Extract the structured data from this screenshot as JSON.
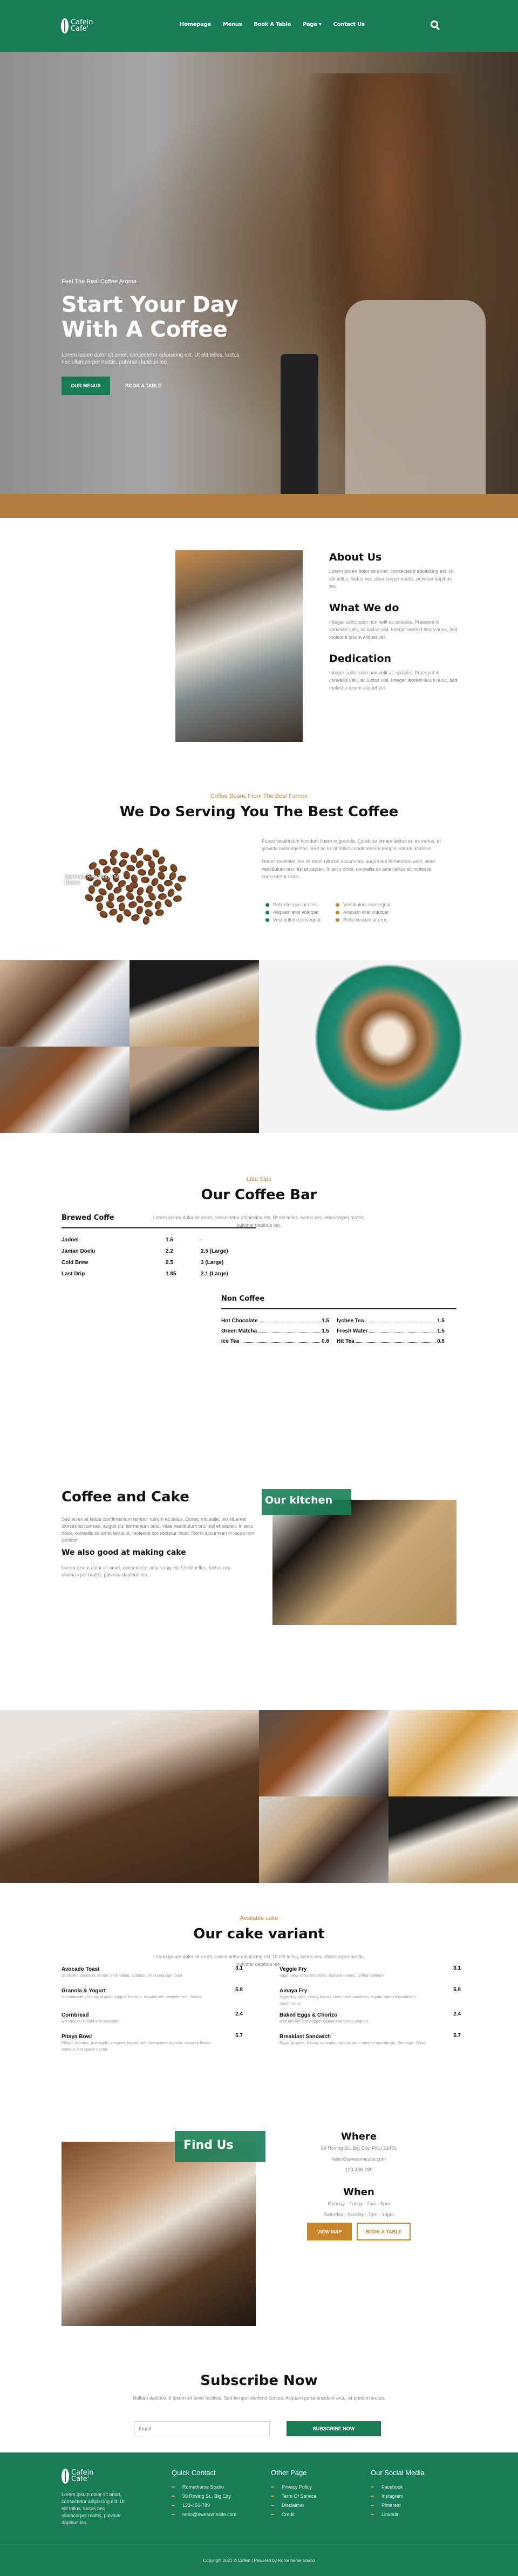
{
  "header": {
    "logo_line1": "Cafein",
    "logo_line2": "Cafe'",
    "nav": [
      "Homepage",
      "Menus",
      "Book A Table",
      "Page ▾",
      "Contact Us"
    ]
  },
  "hero": {
    "tagline": "Feel The Real Coffee Aroma",
    "title": "Start Your Day With A Coffee",
    "description": "Lorem ipsum dolor sit amet, consectetur adipiscing elit. Ut elit tellus, luctus nec ullamcorper mattis, pulvinar dapibus leo.",
    "primary_button": "OUR MENUS",
    "secondary_button": "BOOK A TABLE"
  },
  "about": {
    "blocks": [
      {
        "title": "About Us",
        "text": "Lorem ipsum dolor sit amet, consectetur adipiscing elit. Ut elit tellus, luctus nec ullamcorper mattis, pulvinar dapibus leo."
      },
      {
        "title": "What We do",
        "text": "Integer sollicitudin non velit ac sodales. Praesent id convallis velit, ac luctus nisi. Integer laoreet lacus nunc, sed molestie ipsum aliquet vel."
      },
      {
        "title": "Dedication",
        "text": "Integer sollicitudin non velit ac sodales. Praesent id convallis velit, ac luctus nisi. Integer laoreet lacus nunc, sed molestie ipsum aliquet vel."
      }
    ]
  },
  "serving": {
    "kicker": "Coffee Beans From The Best Farmer",
    "title": "We Do Serving You The Best Coffee",
    "image_label": "Specialy Selecting The Beans",
    "para1": "Fusce vestibulum tincidunt libero in gravida.  Curabitur ornare lectus eu ex varius, et gravida nulla egestas. Sed ac ex at tellus condimentum tempor rutrum ac tellus.",
    "para2": "Donec molestie, leo sit amet ultrices accumsan, augue dui fermentum odio, vitae vestibulum orci nisl et sapien. In arcu dolor, convallis sit amet tellus id, molestie consectetur dolor.",
    "bullets_left": [
      "Pellentesque at eros",
      "Aliquam erat volutpat",
      "Vestibulum consequat"
    ],
    "bullets_right": [
      "Vestibulum consequat",
      "Aliquam erat volutpat",
      "Pellentesque at eros"
    ],
    "bullet_colors": {
      "left": "#187d57",
      "right": "#d0861f"
    }
  },
  "coffee_bar": {
    "kicker": "Litte Sips",
    "title": "Our Coffee Bar",
    "description": "Lorem ipsum dolor sit amet, consectetur adipiscing elit. Ut elit tellus, luctus nec ullamcorper mattis, pulvinar dapibus leo.",
    "brewed_title": "Brewed Coffe",
    "brewed": [
      {
        "name": "Jadoel",
        "price": "1.5",
        "large": "-"
      },
      {
        "name": "Jaman Doelu",
        "price": "2.2",
        "large": "2.5 (Large)"
      },
      {
        "name": "Cold Brew",
        "price": "2.5",
        "large": "3 (Large)"
      },
      {
        "name": "Last Drip",
        "price": "1.85",
        "large": "2.1 (Large)"
      }
    ],
    "non_coffee_title": "Non Coffee",
    "non_coffee": [
      {
        "name": "Hot Chocolate",
        "price": "1.5"
      },
      {
        "name": "lychee Tea",
        "price": "1.5"
      },
      {
        "name": "Green Matcha",
        "price": "1.5"
      },
      {
        "name": "Fresh Water",
        "price": "1.5"
      },
      {
        "name": "Ice Tea",
        "price": "0.8"
      },
      {
        "name": "Hit Tea",
        "price": "0.8"
      }
    ]
  },
  "coffee_cake": {
    "title": "Coffee and Cake",
    "text": "Sed ac ex at tellus condimentum tempor rutrum ac tellus. Donec molestie, leo sit amet ultrices accumsan, augue dui fermentum odio, vitae vestibulum orci nisl et sapien. In arcu dolor, convallis sit amet tellus id, molestie consectetur dolor. Morbi accumsan in lacus non porttitor.",
    "subtitle": "We also good at making cake",
    "subtext": "Lorem ipsum dolor sit amet, consectetur adipiscing elit. Ut elit tellus, luctus nec ullamcorper mattis, pulvinar dapibus leo.",
    "kitchen_label": "Our kitchen"
  },
  "cake_variant": {
    "kicker": "Available cake",
    "title": "Our cake variant",
    "description": "Lorem ipsum dolor sit amet, consectetur adipiscing elit. Ut elit tellus, luctus nec ullamcorper mattis, pulvinar dapibus leo.",
    "items": [
      {
        "name": "Avocado Toast",
        "desc": "Smashed avocado, lemon, chili flakes, spinach, on sourdough toast",
        "price": "3.1"
      },
      {
        "name": "Veggie Fry",
        "desc": "eggs, slow roast tomatoes, roasted onions, grilled halloumi",
        "price": "3.1"
      },
      {
        "name": "Granola & Yogurt",
        "desc": "Housemade granola, organic yogurt, banana, raspberries, strawberries, honey",
        "price": "5.8"
      },
      {
        "name": "Amaya Fry",
        "desc": "Eggs any style, crispy bacon, slow roast tomatoes, thyme roasted portobello mushrooms",
        "price": "5.8"
      },
      {
        "name": "Cornbread",
        "desc": "with bacon, rucola and avocado",
        "price": "2.4"
      },
      {
        "name": "Baked Eggs & Chorizo",
        "desc": "with tomato and pepper ragout and greek yoghurt",
        "price": "2.4"
      },
      {
        "name": "Pitaya Bowl",
        "desc": "Pitaya, banana, pineapple, coconut, topped with hempseed granola, coconut flakes, banana and agave nectar",
        "price": "5.7"
      },
      {
        "name": "Breakfast Sandwich",
        "desc": "Eggs, gruyere, bacon, avocado, sprouts aioli, toasted sourdough, Sousage, Onion",
        "price": "5.7"
      }
    ]
  },
  "find_us": {
    "label": "Find Us",
    "where_title": "Where",
    "address": "99 Roving St., Big City, PKU 23456",
    "email": "hello@awesomesite.com",
    "phone": "123-456-789",
    "when_title": "When",
    "weekday": "Monday - Friday : 7am - 8pm",
    "weekend": "Saturday - Sunday : 7am - 10pm",
    "map_button": "VIEW MAP",
    "book_button": "BOOK A TABLE"
  },
  "subscribe": {
    "title": "Subscribe Now",
    "text": "Nullam dapibus id ipsum sit amet facilisis. Sed tempor eleifend cursus. Aliquam porta tincidunt arcu, et pretium lectus.",
    "placeholder": "Email",
    "button": "SUBSCRIBE NOW"
  },
  "footer": {
    "logo_line1": "Cafein",
    "logo_line2": "Cafe'",
    "desc": "Lorem ipsum dolor sit amet, consectetur adipiscing elit. Ut elit tellus, luctus nec ullamcorper mattis, pulvinar dapibus leo.",
    "columns": [
      {
        "title": "Quick Contact",
        "items": [
          "Rometheme Studio",
          "99 Roving St., Big City",
          "123-456-789",
          "hello@awesomesite.com"
        ]
      },
      {
        "title": "Other Page",
        "items": [
          "Privacy Policy",
          "Term Of Service",
          "Disclaimer",
          "Credit"
        ]
      },
      {
        "title": "Our Social Media",
        "items": [
          "Facebook",
          "Instagram",
          "Pinterest",
          "Linkedin"
        ]
      }
    ],
    "copyright": "Copyright 2021 © Cafein | Powered by Rometheme Studio"
  },
  "colors": {
    "brand_green": "#187d57",
    "accent_orange": "#c8842d"
  }
}
